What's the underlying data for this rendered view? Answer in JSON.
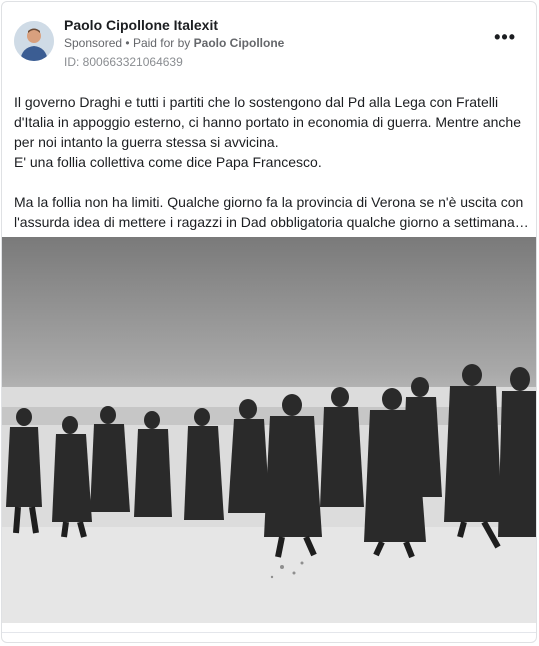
{
  "ad": {
    "page_name": "Paolo Cipollone Italexit",
    "sponsored_label": "Sponsored",
    "separator": "•",
    "paid_for_label": "Paid for by",
    "paid_for_name": "Paolo Cipollone",
    "id_text": "ID: 800663321064639",
    "more_icon": "more-horizontal-icon",
    "more_label": "•••"
  },
  "post": {
    "paragraph_1": "Il governo Draghi e tutti i partiti che lo sostengono dal Pd alla Lega con Fratelli d'Italia in appoggio esterno, ci hanno portato in economia di guerra. Mentre anche per noi intanto la guerra stessa si avvicina.",
    "paragraph_2": "E' una follia collettiva come dice Papa Francesco.",
    "paragraph_3": "Ma la follia non ha limiti. Qualche giorno fa la provincia di Verona se n'è uscita con l'assurda idea di mettere i ragazzi in Dad obbligatoria qualche giorno a settimana…",
    "image_description_icon": "photo-soldiers-in-snow"
  }
}
